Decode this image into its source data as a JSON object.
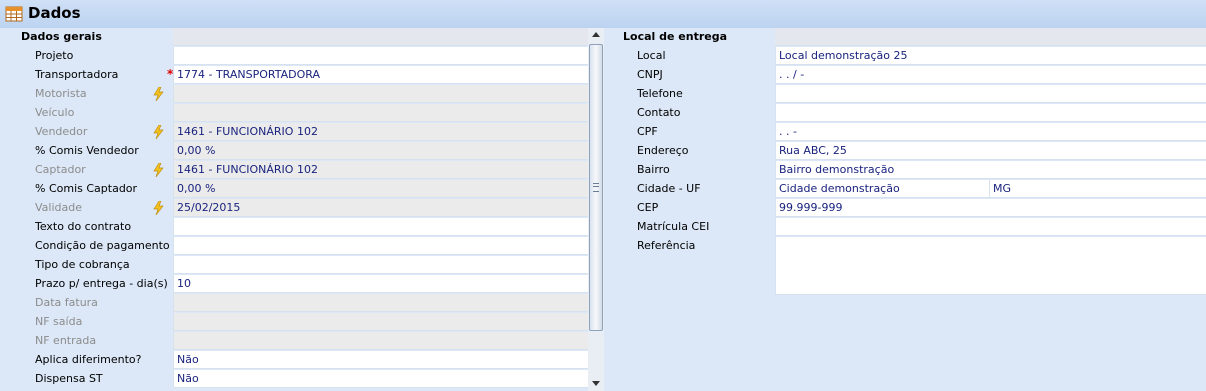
{
  "title": "Dados",
  "icons": {
    "window": "table-icon",
    "bolt": "lightning-icon",
    "required": "asterisk-icon"
  },
  "colors": {
    "header_bg": "#c8dcf4",
    "panel_bg": "#dce8f7",
    "value_text": "#1a237e",
    "required": "#dd0000"
  },
  "left": {
    "section": "Dados gerais",
    "fields": [
      {
        "label": "Projeto",
        "value": ""
      },
      {
        "label": "Transportadora",
        "value": "1774 - TRANSPORTADORA"
      },
      {
        "label": "Motorista",
        "value": ""
      },
      {
        "label": "Veículo",
        "value": ""
      },
      {
        "label": "Vendedor",
        "value": "1461 - FUNCIONÁRIO 102"
      },
      {
        "label": "% Comis Vendedor",
        "value": " 0,00 %"
      },
      {
        "label": "Captador",
        "value": "1461 - FUNCIONÁRIO 102"
      },
      {
        "label": "% Comis Captador",
        "value": " 0,00 %"
      },
      {
        "label": "Validade",
        "value": "25/02/2015"
      },
      {
        "label": "Texto do contrato",
        "value": ""
      },
      {
        "label": "Condição de pagamento",
        "value": ""
      },
      {
        "label": "Tipo de cobrança",
        "value": ""
      },
      {
        "label": "Prazo p/ entrega - dia(s)",
        "value": "10"
      },
      {
        "label": "Data fatura",
        "value": ""
      },
      {
        "label": "NF saída",
        "value": ""
      },
      {
        "label": "NF entrada",
        "value": ""
      },
      {
        "label": "Aplica diferimento?",
        "value": "Não"
      },
      {
        "label": "Dispensa ST",
        "value": "Não"
      }
    ]
  },
  "right": {
    "section": "Local de entrega",
    "fields": [
      {
        "label": "Local",
        "value": "Local demonstração 25"
      },
      {
        "label": "CNPJ",
        "value": "  .   .   /    -"
      },
      {
        "label": "Telefone",
        "value": ""
      },
      {
        "label": "Contato",
        "value": ""
      },
      {
        "label": "CPF",
        "value": "   .   .   -"
      },
      {
        "label": "Endereço",
        "value": "Rua ABC, 25"
      },
      {
        "label": "Bairro",
        "value": "Bairro demonstração"
      },
      {
        "label": "Cidade - UF",
        "value": "Cidade demonstração",
        "uf": "MG"
      },
      {
        "label": "CEP",
        "value": "99.999-999"
      },
      {
        "label": "Matrícula CEI",
        "value": ""
      },
      {
        "label": "Referência",
        "value": ""
      }
    ]
  }
}
